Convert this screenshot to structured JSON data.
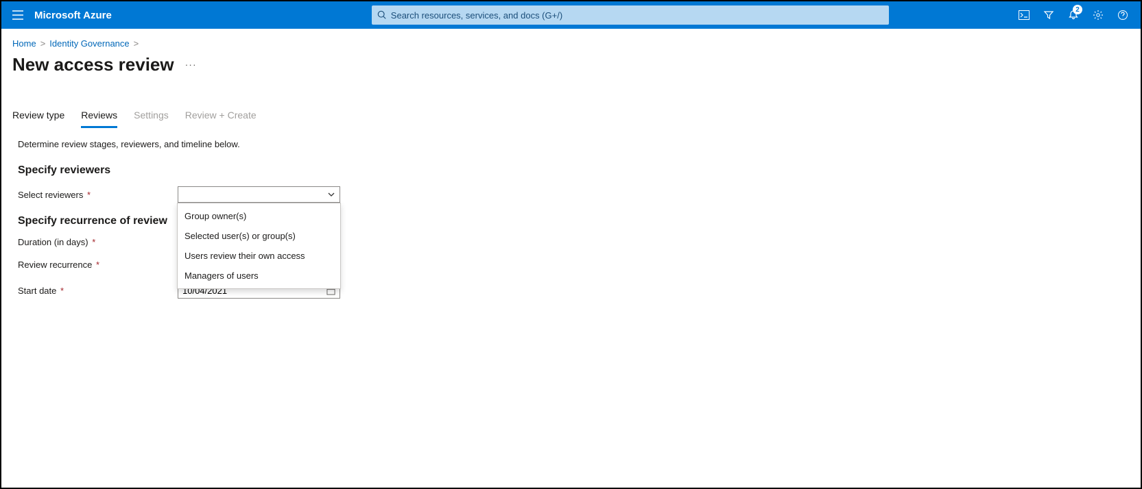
{
  "header": {
    "brand": "Microsoft Azure",
    "search_placeholder": "Search resources, services, and docs (G+/)",
    "notification_count": "2"
  },
  "breadcrumb": {
    "items": [
      "Home",
      "Identity Governance"
    ]
  },
  "page": {
    "title": "New access review"
  },
  "tabs": [
    {
      "label": "Review type",
      "state": "normal"
    },
    {
      "label": "Reviews",
      "state": "active"
    },
    {
      "label": "Settings",
      "state": "disabled"
    },
    {
      "label": "Review + Create",
      "state": "disabled"
    }
  ],
  "content": {
    "description": "Determine review stages, reviewers, and timeline below.",
    "section1_heading": "Specify reviewers",
    "select_reviewers_label": "Select reviewers",
    "reviewers_dropdown": {
      "selected": "",
      "options": [
        "Group owner(s)",
        "Selected user(s) or group(s)",
        "Users review their own access",
        "Managers of users"
      ]
    },
    "section2_heading": "Specify recurrence of review",
    "duration_label": "Duration (in days)",
    "recurrence_label": "Review recurrence",
    "start_date_label": "Start date",
    "start_date_value": "10/04/2021"
  }
}
